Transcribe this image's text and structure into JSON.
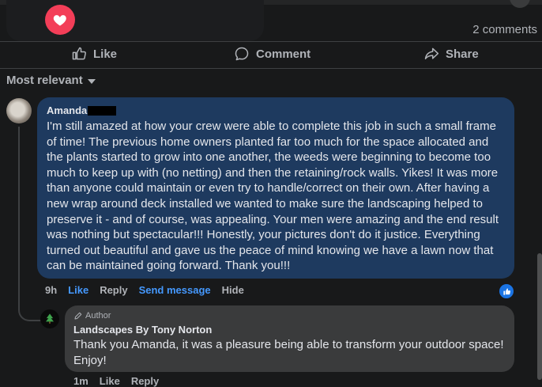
{
  "post": {
    "reaction_icon": "heart-icon",
    "comments_count": "2 comments"
  },
  "actions": {
    "like": "Like",
    "comment": "Comment",
    "share": "Share"
  },
  "sort": {
    "label": "Most relevant"
  },
  "comment": {
    "author": "Amanda",
    "text": "I'm still amazed at how your crew were able to complete this job in such a small frame of time! The previous home owners planted far too much for the space allocated and the plants started to grow into one another, the weeds were beginning to become too much to keep up with (no netting) and then the retaining/rock walls. Yikes! It was more than anyone could maintain or even try to handle/correct on their own. After having a new wrap around deck installed we wanted to make sure the landscaping helped to preserve it - and of course, was appealing. Your men were amazing and the end result was nothing but spectacular!!! Honestly, your pictures don't do it justice. Everything turned out beautiful and gave us the peace of mind knowing we have a lawn now that can be maintained going forward. Thank you!!!",
    "time": "9h",
    "like": "Like",
    "reply": "Reply",
    "send_message": "Send message",
    "hide": "Hide"
  },
  "reply": {
    "badge": "Author",
    "author": "Landscapes By Tony Norton",
    "text": "Thank you Amanda, it was a pleasure being able to transform your outdoor space! Enjoy!",
    "time": "1m",
    "like": "Like",
    "reply": "Reply"
  },
  "colors": {
    "background": "#18191a",
    "comment_bubble": "#1e3a5f",
    "reply_bubble": "#3a3b3c",
    "link_blue": "#4599ff",
    "heart_red": "#f33e58"
  }
}
